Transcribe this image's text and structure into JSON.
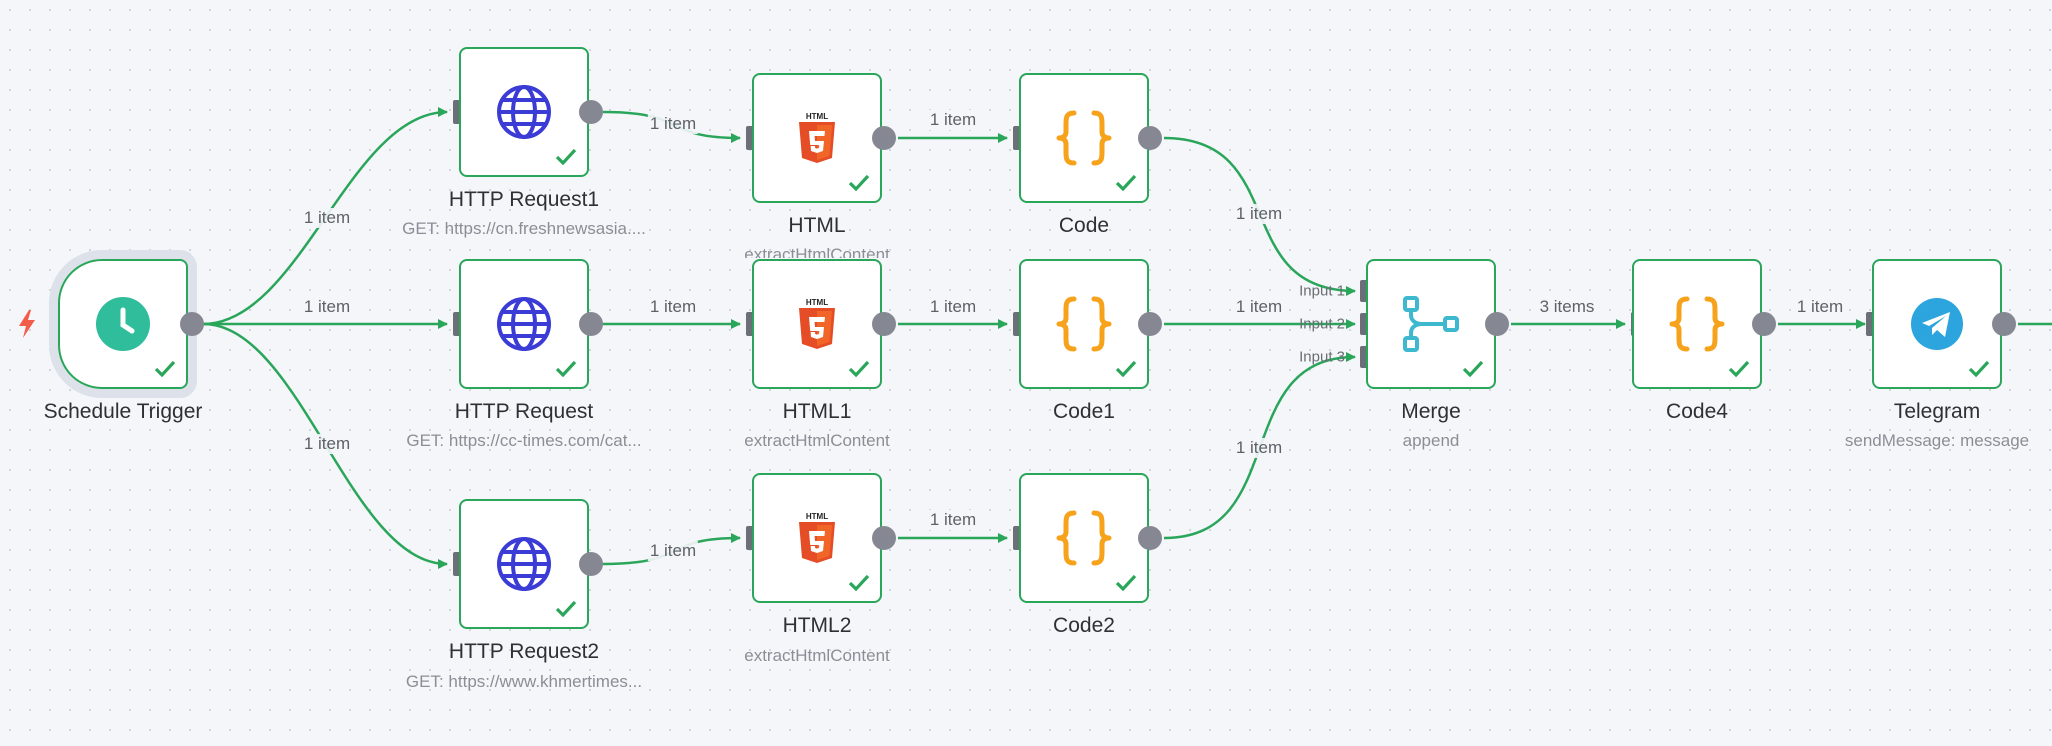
{
  "colors": {
    "edge": "#2aa65b",
    "node_border": "#2aa65b",
    "code_orange": "#f7a21b",
    "globe_blue": "#3b3bd6",
    "merge_teal": "#3db8cf",
    "telegram_blue": "#2ca4de",
    "html_red": "#e44d26",
    "trigger_green": "#2fbd9b",
    "bolt_red": "#f25c4a"
  },
  "nodes": {
    "schedule_trigger": {
      "title": "Schedule Trigger",
      "icon": "clock-icon"
    },
    "http_request1": {
      "title": "HTTP Request1",
      "subtitle": "GET: https://cn.freshnewsasia....",
      "icon": "globe-icon"
    },
    "http_request": {
      "title": "HTTP Request",
      "subtitle": "GET: https://cc-times.com/cat...",
      "icon": "globe-icon"
    },
    "http_request2": {
      "title": "HTTP Request2",
      "subtitle": "GET: https://www.khmertimes...",
      "icon": "globe-icon"
    },
    "html": {
      "title": "HTML",
      "subtitle": "extractHtmlContent",
      "icon": "html5-icon"
    },
    "html1": {
      "title": "HTML1",
      "subtitle": "extractHtmlContent",
      "icon": "html5-icon"
    },
    "html2": {
      "title": "HTML2",
      "subtitle": "extractHtmlContent",
      "icon": "html5-icon"
    },
    "code": {
      "title": "Code",
      "icon": "code-braces-icon"
    },
    "code1": {
      "title": "Code1",
      "icon": "code-braces-icon"
    },
    "code2": {
      "title": "Code2",
      "icon": "code-braces-icon"
    },
    "merge": {
      "title": "Merge",
      "subtitle": "append",
      "icon": "merge-icon",
      "inputs": [
        "Input 1",
        "Input 2",
        "Input 3"
      ]
    },
    "code4": {
      "title": "Code4",
      "icon": "code-braces-icon"
    },
    "telegram": {
      "title": "Telegram",
      "subtitle": "sendMessage: message",
      "icon": "telegram-icon"
    }
  },
  "edges": {
    "trigger_http1": "1 item",
    "trigger_http": "1 item",
    "trigger_http2": "1 item",
    "http1_html": "1 item",
    "http_html1": "1 item",
    "http2_html2": "1 item",
    "html_code": "1 item",
    "html1_code1": "1 item",
    "html2_code2": "1 item",
    "code_merge": "1 item",
    "code1_merge": "1 item",
    "code2_merge": "1 item",
    "merge_code4": "3 items",
    "code4_telegram": "1 item"
  }
}
